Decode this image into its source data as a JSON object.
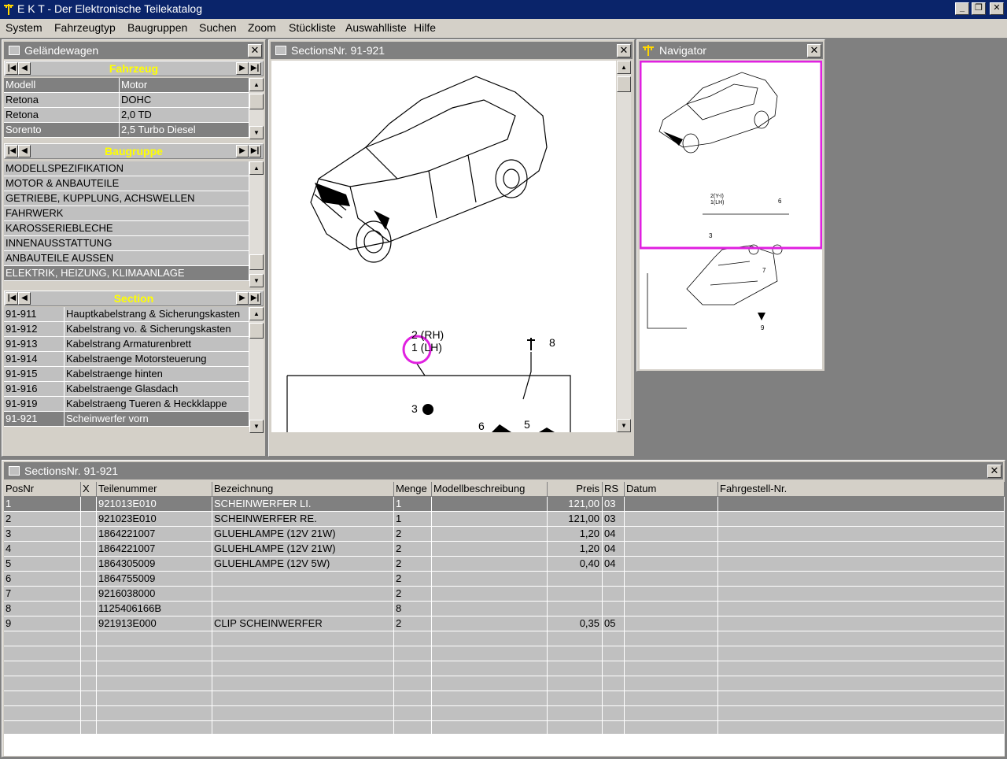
{
  "app": {
    "title": "E K T - Der Elektronische Teilekatalog",
    "minimize": "_",
    "restore": "❐",
    "close": "✕"
  },
  "menu": [
    "System",
    "Fahrzeugtyp",
    "Baugruppen",
    "Suchen",
    "Zoom",
    "Stückliste",
    "Auswahlliste",
    "Hilfe"
  ],
  "left_panel": {
    "title": "Geländewagen",
    "close": "✕",
    "fahrzeug": {
      "header": "Fahrzeug",
      "columns": [
        "Modell",
        "Motor"
      ],
      "rows": [
        [
          "Retona",
          "DOHC"
        ],
        [
          "Retona",
          "2,0 TD"
        ],
        [
          "Sorento",
          "2,5 Turbo Diesel"
        ]
      ],
      "selected": 2
    },
    "baugruppe": {
      "header": "Baugruppe",
      "rows": [
        "MODELLSPEZIFIKATION",
        "MOTOR & ANBAUTEILE",
        "GETRIEBE, KUPPLUNG, ACHSWELLEN",
        "FAHRWERK",
        "KAROSSERIEBLECHE",
        "INNENAUSSTATTUNG",
        "ANBAUTEILE AUSSEN",
        "ELEKTRIK, HEIZUNG, KLIMAANLAGE"
      ],
      "selected": 7
    },
    "section": {
      "header": "Section",
      "rows": [
        [
          "91-911",
          "Hauptkabelstrang & Sicherungskasten"
        ],
        [
          "91-912",
          "Kabelstrang vo. & Sicherungskasten"
        ],
        [
          "91-913",
          "Kabelstrang Armaturenbrett"
        ],
        [
          "91-914",
          "Kabelstraenge Motorsteuerung"
        ],
        [
          "91-915",
          "Kabelstraenge hinten"
        ],
        [
          "91-916",
          "Kabelstraenge Glasdach"
        ],
        [
          "91-919",
          "Kabelstraeng Tueren & Heckklappe"
        ],
        [
          "91-921",
          "Scheinwerfer vorn"
        ]
      ],
      "selected": 7
    }
  },
  "drawing_panel": {
    "title": "SectionsNr. 91-921",
    "close": "✕",
    "labels": {
      "rh": "2 (RH)",
      "lh": "1 (LH)",
      "p8": "8",
      "p3": "3",
      "p6": "6",
      "p5": "5"
    }
  },
  "navigator": {
    "title": "Navigator",
    "close": "✕",
    "labels": {
      "rh_lh": "2(Y-I)\n1(LH)",
      "p6": "6",
      "p3": "3",
      "p7": "7",
      "p9": "9"
    }
  },
  "parts_panel": {
    "title": "SectionsNr. 91-921",
    "close": "✕",
    "columns": [
      "PosNr",
      "X",
      "Teilenummer",
      "Bezeichnung",
      "Menge",
      "Modellbeschreibung",
      "Preis",
      "RS",
      "Datum",
      "Fahrgestell-Nr."
    ],
    "rows": [
      [
        "1",
        "",
        "921013E010",
        "SCHEINWERFER LI.",
        "1",
        "",
        "121,00",
        "03",
        "",
        ""
      ],
      [
        "2",
        "",
        "921023E010",
        "SCHEINWERFER RE.",
        "1",
        "",
        "121,00",
        "03",
        "",
        ""
      ],
      [
        "3",
        "",
        "1864221007",
        "GLUEHLAMPE (12V 21W)",
        "2",
        "",
        "1,20",
        "04",
        "",
        ""
      ],
      [
        "4",
        "",
        "1864221007",
        "GLUEHLAMPE (12V 21W)",
        "2",
        "",
        "1,20",
        "04",
        "",
        ""
      ],
      [
        "5",
        "",
        "1864305009",
        "GLUEHLAMPE (12V 5W)",
        "2",
        "",
        "0,40",
        "04",
        "",
        ""
      ],
      [
        "6",
        "",
        "1864755009",
        "",
        "2",
        "",
        "",
        "",
        "",
        ""
      ],
      [
        "7",
        "",
        "9216038000",
        "",
        "2",
        "",
        "",
        "",
        "",
        ""
      ],
      [
        "8",
        "",
        "1125406166B",
        "",
        "8",
        "",
        "",
        "",
        "",
        ""
      ],
      [
        "9",
        "",
        "921913E000",
        "CLIP SCHEINWERFER",
        "2",
        "",
        "0,35",
        "05",
        "",
        ""
      ]
    ],
    "empty_rows": 7,
    "selected": 0
  }
}
